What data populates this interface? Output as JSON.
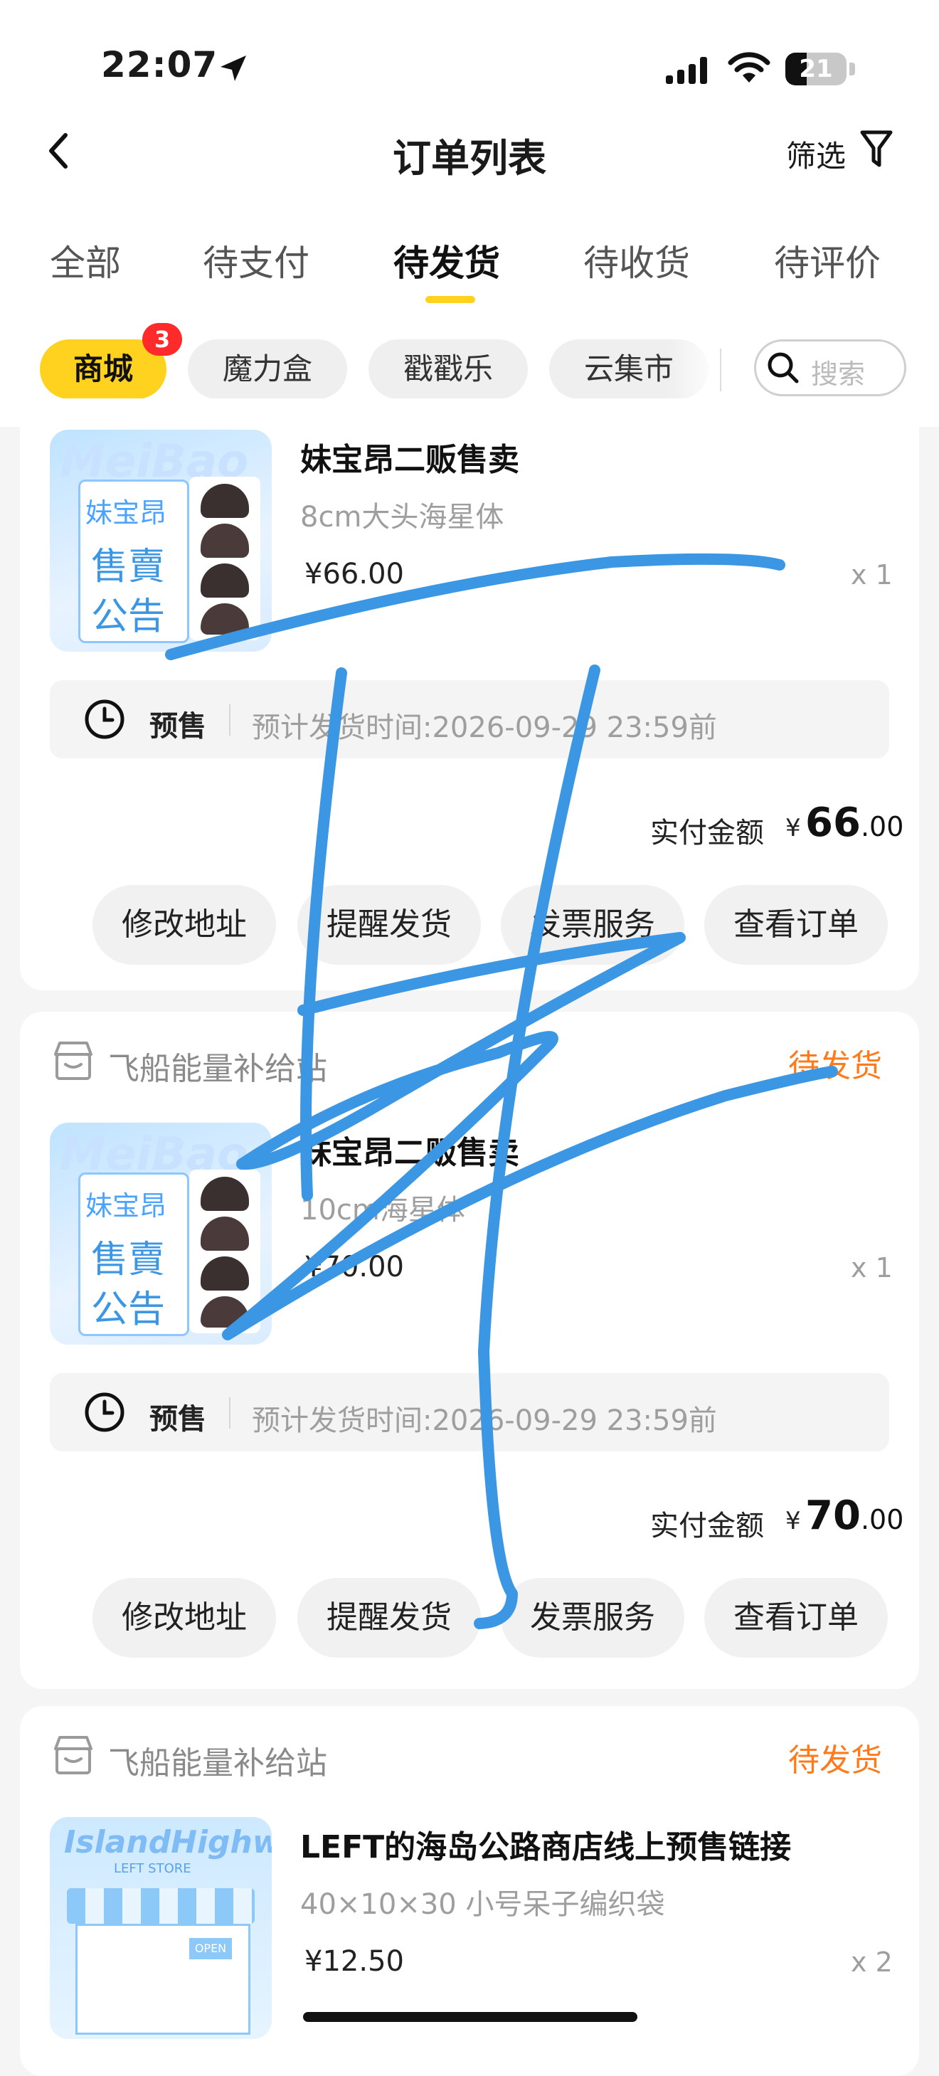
{
  "status_bar": {
    "time": "22:07",
    "battery": "21"
  },
  "nav": {
    "title": "订单列表",
    "filter_label": "筛选"
  },
  "tabs": [
    {
      "label": "全部"
    },
    {
      "label": "待支付"
    },
    {
      "label": "待发货",
      "active": true
    },
    {
      "label": "待收货"
    },
    {
      "label": "待评价"
    }
  ],
  "chips": [
    {
      "label": "商城",
      "active": true,
      "badge": "3"
    },
    {
      "label": "魔力盒"
    },
    {
      "label": "戳戳乐"
    },
    {
      "label": "云集市"
    }
  ],
  "search": {
    "placeholder": "搜索"
  },
  "orders": [
    {
      "product_name": "妹宝昂二贩售卖",
      "spec": "8cm大头海星体",
      "price": "¥66.00",
      "qty": "x 1",
      "presale_tag": "预售",
      "presale_text": "预计发货时间:2026-09-29 23:59前",
      "amount_label": "实付金额",
      "amount_currency": "¥",
      "amount_int": "66",
      "amount_dec": ".00",
      "buttons": [
        "修改地址",
        "提醒发货",
        "发票服务",
        "查看订单"
      ]
    },
    {
      "store_name": "飞船能量补给站",
      "status": "待发货",
      "product_name": "妹宝昂二贩售卖",
      "spec": "10cm海星体",
      "price": "¥70.00",
      "qty": "x 1",
      "presale_tag": "预售",
      "presale_text": "预计发货时间:2026-09-29 23:59前",
      "amount_label": "实付金额",
      "amount_currency": "¥",
      "amount_int": "70",
      "amount_dec": ".00",
      "buttons": [
        "修改地址",
        "提醒发货",
        "发票服务",
        "查看订单"
      ]
    },
    {
      "store_name": "飞船能量补给站",
      "status": "待发货",
      "product_name": "LEFT的海岛公路商店线上预售链接",
      "spec": "40×10×30 小号呆子编织袋",
      "price": "¥12.50",
      "qty": "x 2"
    }
  ],
  "thumbs": {
    "meibao": {
      "title_line1": "妹宝昂",
      "title_line2": "售賣",
      "title_line3": "公告",
      "logo": "MeiBao"
    },
    "island": {
      "logo": "IslandHighway",
      "sub": "LEFT STORE",
      "sign": "OPEN"
    }
  },
  "colors": {
    "accent": "#ffd21f",
    "status": "#ff7a1a",
    "badge": "#ff2b2b",
    "scribble": "#3b97e4"
  }
}
